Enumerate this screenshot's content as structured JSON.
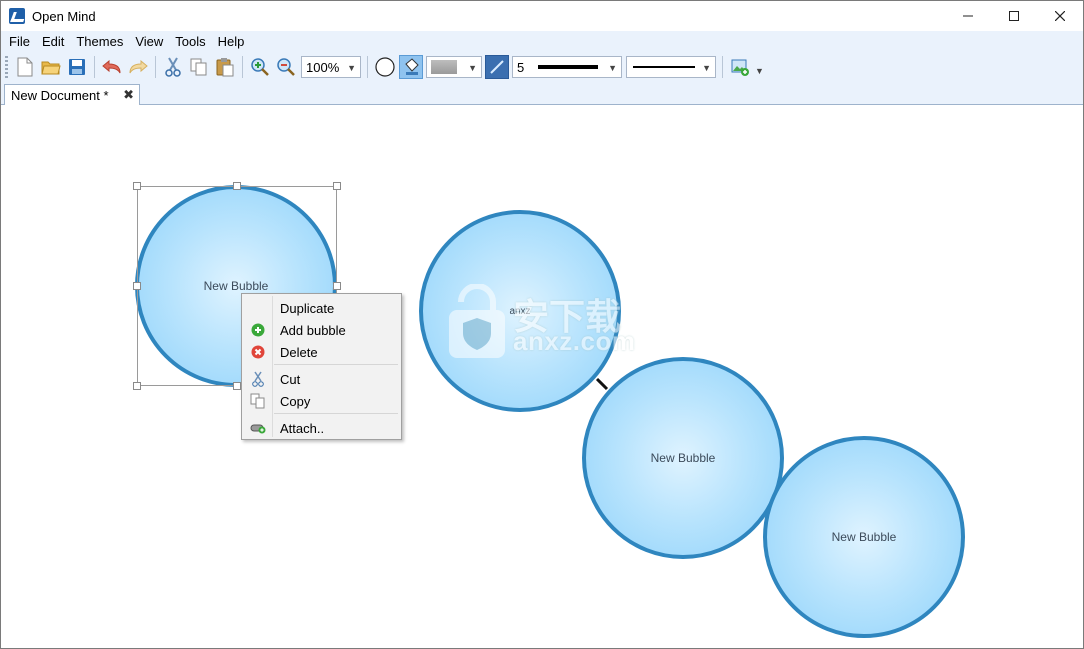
{
  "window": {
    "title": "Open Mind"
  },
  "menu": {
    "items": [
      "File",
      "Edit",
      "Themes",
      "View",
      "Tools",
      "Help"
    ]
  },
  "toolbar": {
    "zoom": "100%",
    "line_width": "5",
    "icons": [
      "new-icon",
      "open-icon",
      "save-icon",
      "undo-icon",
      "redo-icon",
      "cut-icon",
      "copy-icon",
      "paste-icon",
      "zoom-in-icon",
      "zoom-out-icon"
    ]
  },
  "tabs": [
    {
      "label": "New Document *"
    }
  ],
  "canvas": {
    "bubbles": [
      {
        "label": "New Bubble"
      },
      {
        "label": "anxz"
      },
      {
        "label": "New Bubble"
      },
      {
        "label": "New Bubble"
      }
    ],
    "watermark": {
      "text_cn": "安下载",
      "text_en": "anxz.com"
    }
  },
  "context_menu": {
    "items": [
      {
        "label": "Duplicate",
        "icon": ""
      },
      {
        "label": "Add bubble",
        "icon": "add-icon"
      },
      {
        "label": "Delete",
        "icon": "delete-icon"
      },
      {
        "label": "Cut",
        "icon": "cut-icon"
      },
      {
        "label": "Copy",
        "icon": "copy-icon"
      },
      {
        "label": "Attach..",
        "icon": "attach-icon"
      }
    ]
  },
  "colors": {
    "accent": "#2f86bf",
    "bubble_fill": "#b9e4fd",
    "chrome": "#eaf2fc"
  }
}
